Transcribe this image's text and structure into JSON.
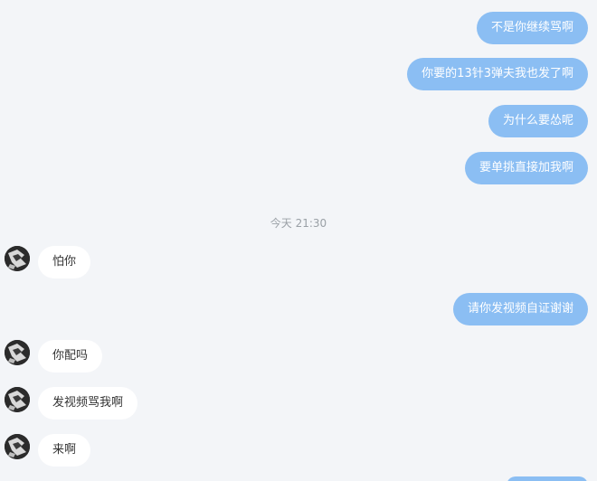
{
  "messages": [
    {
      "direction": "out",
      "text": "不是你继续骂啊"
    },
    {
      "direction": "out",
      "text": "你要的13针3弹夫我也发了啊"
    },
    {
      "direction": "out",
      "text": "为什么要怂呢"
    },
    {
      "direction": "out",
      "text": "要单挑直接加我啊"
    },
    {
      "direction": "in",
      "text": "怕你"
    },
    {
      "direction": "out",
      "text": "请你发视频自证谢谢"
    },
    {
      "direction": "in",
      "text": "你配吗"
    },
    {
      "direction": "in",
      "text": "发视频骂我啊"
    },
    {
      "direction": "in",
      "text": "来啊"
    }
  ],
  "timestamp": "今天 21:30",
  "colors": {
    "background": "#f3f5f8",
    "outgoing_bubble": "#8bbef3",
    "incoming_bubble": "#ffffff",
    "timestamp_text": "#9aa0a6"
  },
  "icons": {
    "contact_avatar": "avatar"
  }
}
